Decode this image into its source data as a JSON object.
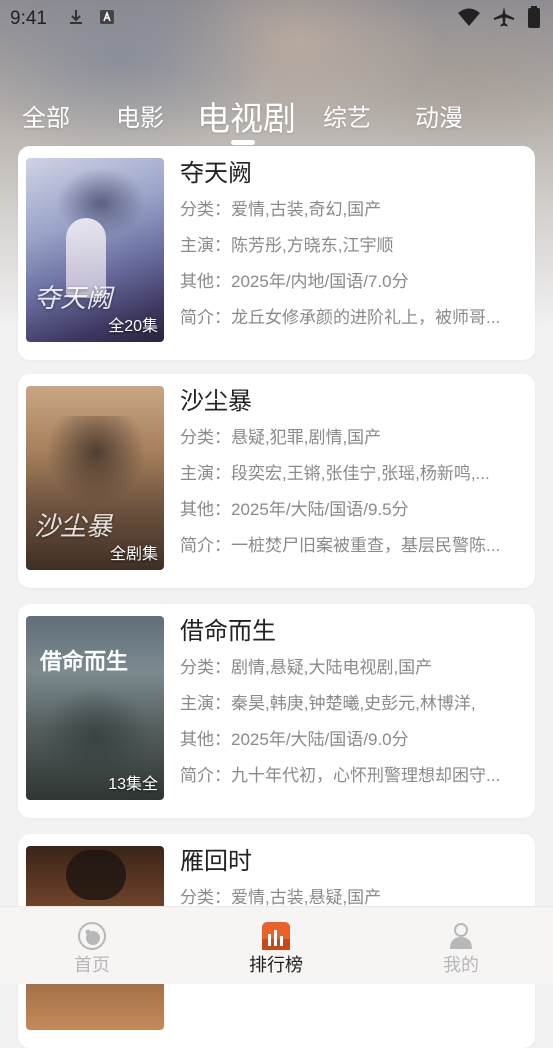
{
  "status_bar": {
    "time": "9:41"
  },
  "tabs": [
    {
      "label": "全部",
      "active": false
    },
    {
      "label": "电影",
      "active": false
    },
    {
      "label": "电视剧",
      "active": true
    },
    {
      "label": "综艺",
      "active": false
    },
    {
      "label": "动漫",
      "active": false
    }
  ],
  "list": [
    {
      "title": "夺天阙",
      "category": "分类：爱情,古装,奇幻,国产",
      "cast": "主演：陈芳彤,方晓东,江宇顺",
      "other": "其他：2025年/内地/国语/7.0分",
      "intro": "简介：龙丘女修承颜的进阶礼上，被师哥...",
      "badge": "全20集",
      "poster_art": "夺天阙"
    },
    {
      "title": "沙尘暴",
      "category": "分类：悬疑,犯罪,剧情,国产",
      "cast": "主演：段奕宏,王锵,张佳宁,张瑶,杨新鸣,...",
      "other": "其他：2025年/大陆/国语/9.5分",
      "intro": "简介：一桩焚尸旧案被重查，基层民警陈...",
      "badge": "全剧集",
      "poster_art": "沙尘暴"
    },
    {
      "title": "借命而生",
      "category": "分类：剧情,悬疑,大陆电视剧,国产",
      "cast": "主演：秦昊,韩庚,钟楚曦,史彭元,林博洋,",
      "other": "其他：2025年/大陆/国语/9.0分",
      "intro": "简介：九十年代初，心怀刑警理想却困守...",
      "badge": "13集全",
      "poster_art": "借命而生"
    },
    {
      "title": "雁回时",
      "category": "分类：爱情,古装,悬疑,国产",
      "cast": "",
      "other": "",
      "intro": "",
      "badge": "",
      "poster_art": ""
    }
  ],
  "bottom_nav": [
    {
      "label": "首页",
      "icon": "home-icon",
      "active": false
    },
    {
      "label": "排行榜",
      "icon": "ranking-icon",
      "active": true
    },
    {
      "label": "我的",
      "icon": "profile-icon",
      "active": false
    }
  ],
  "colors": {
    "accent": "#e8622a",
    "background": "#f2f2f2",
    "muted_text": "#8a8a8a"
  }
}
